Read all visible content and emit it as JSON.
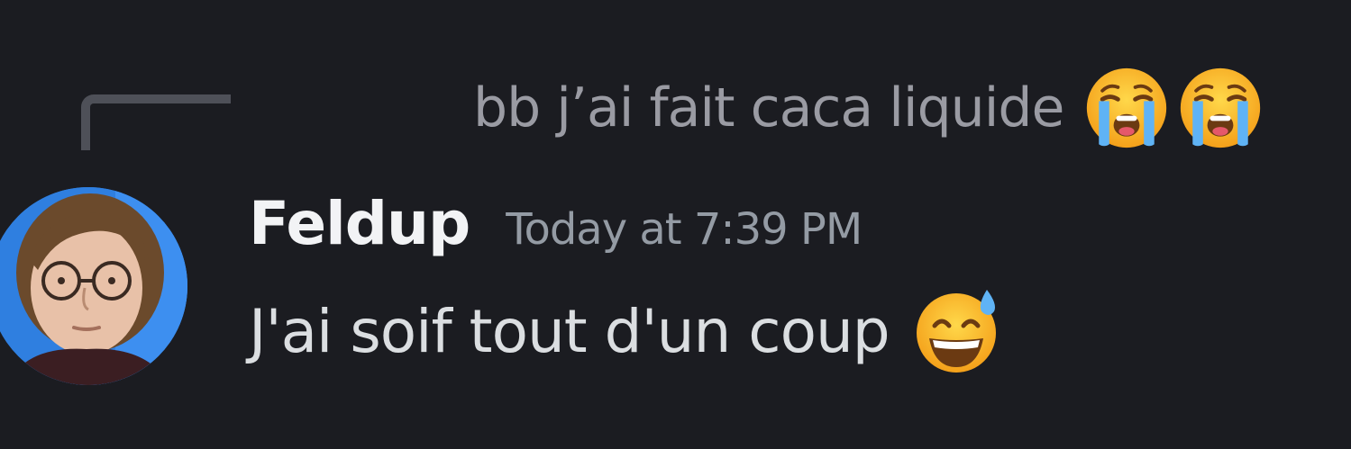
{
  "reply": {
    "text": "bb j’ai fait caca liquide",
    "emojis": [
      "loudly-crying-face-icon",
      "loudly-crying-face-icon"
    ]
  },
  "message": {
    "author": "Feldup",
    "timestamp": "Today at 7:39 PM",
    "text": "J'ai soif tout d'un coup",
    "emoji": "grinning-face-with-sweat-icon"
  },
  "colors": {
    "background": "#1b1c21",
    "username": "#f2f3f5",
    "timestamp": "#949ba4",
    "message_text": "#dbdee1",
    "reply_text": "#9a9ba3",
    "reply_spine": "#4e5058",
    "avatar_background": "#2f7fe0"
  }
}
